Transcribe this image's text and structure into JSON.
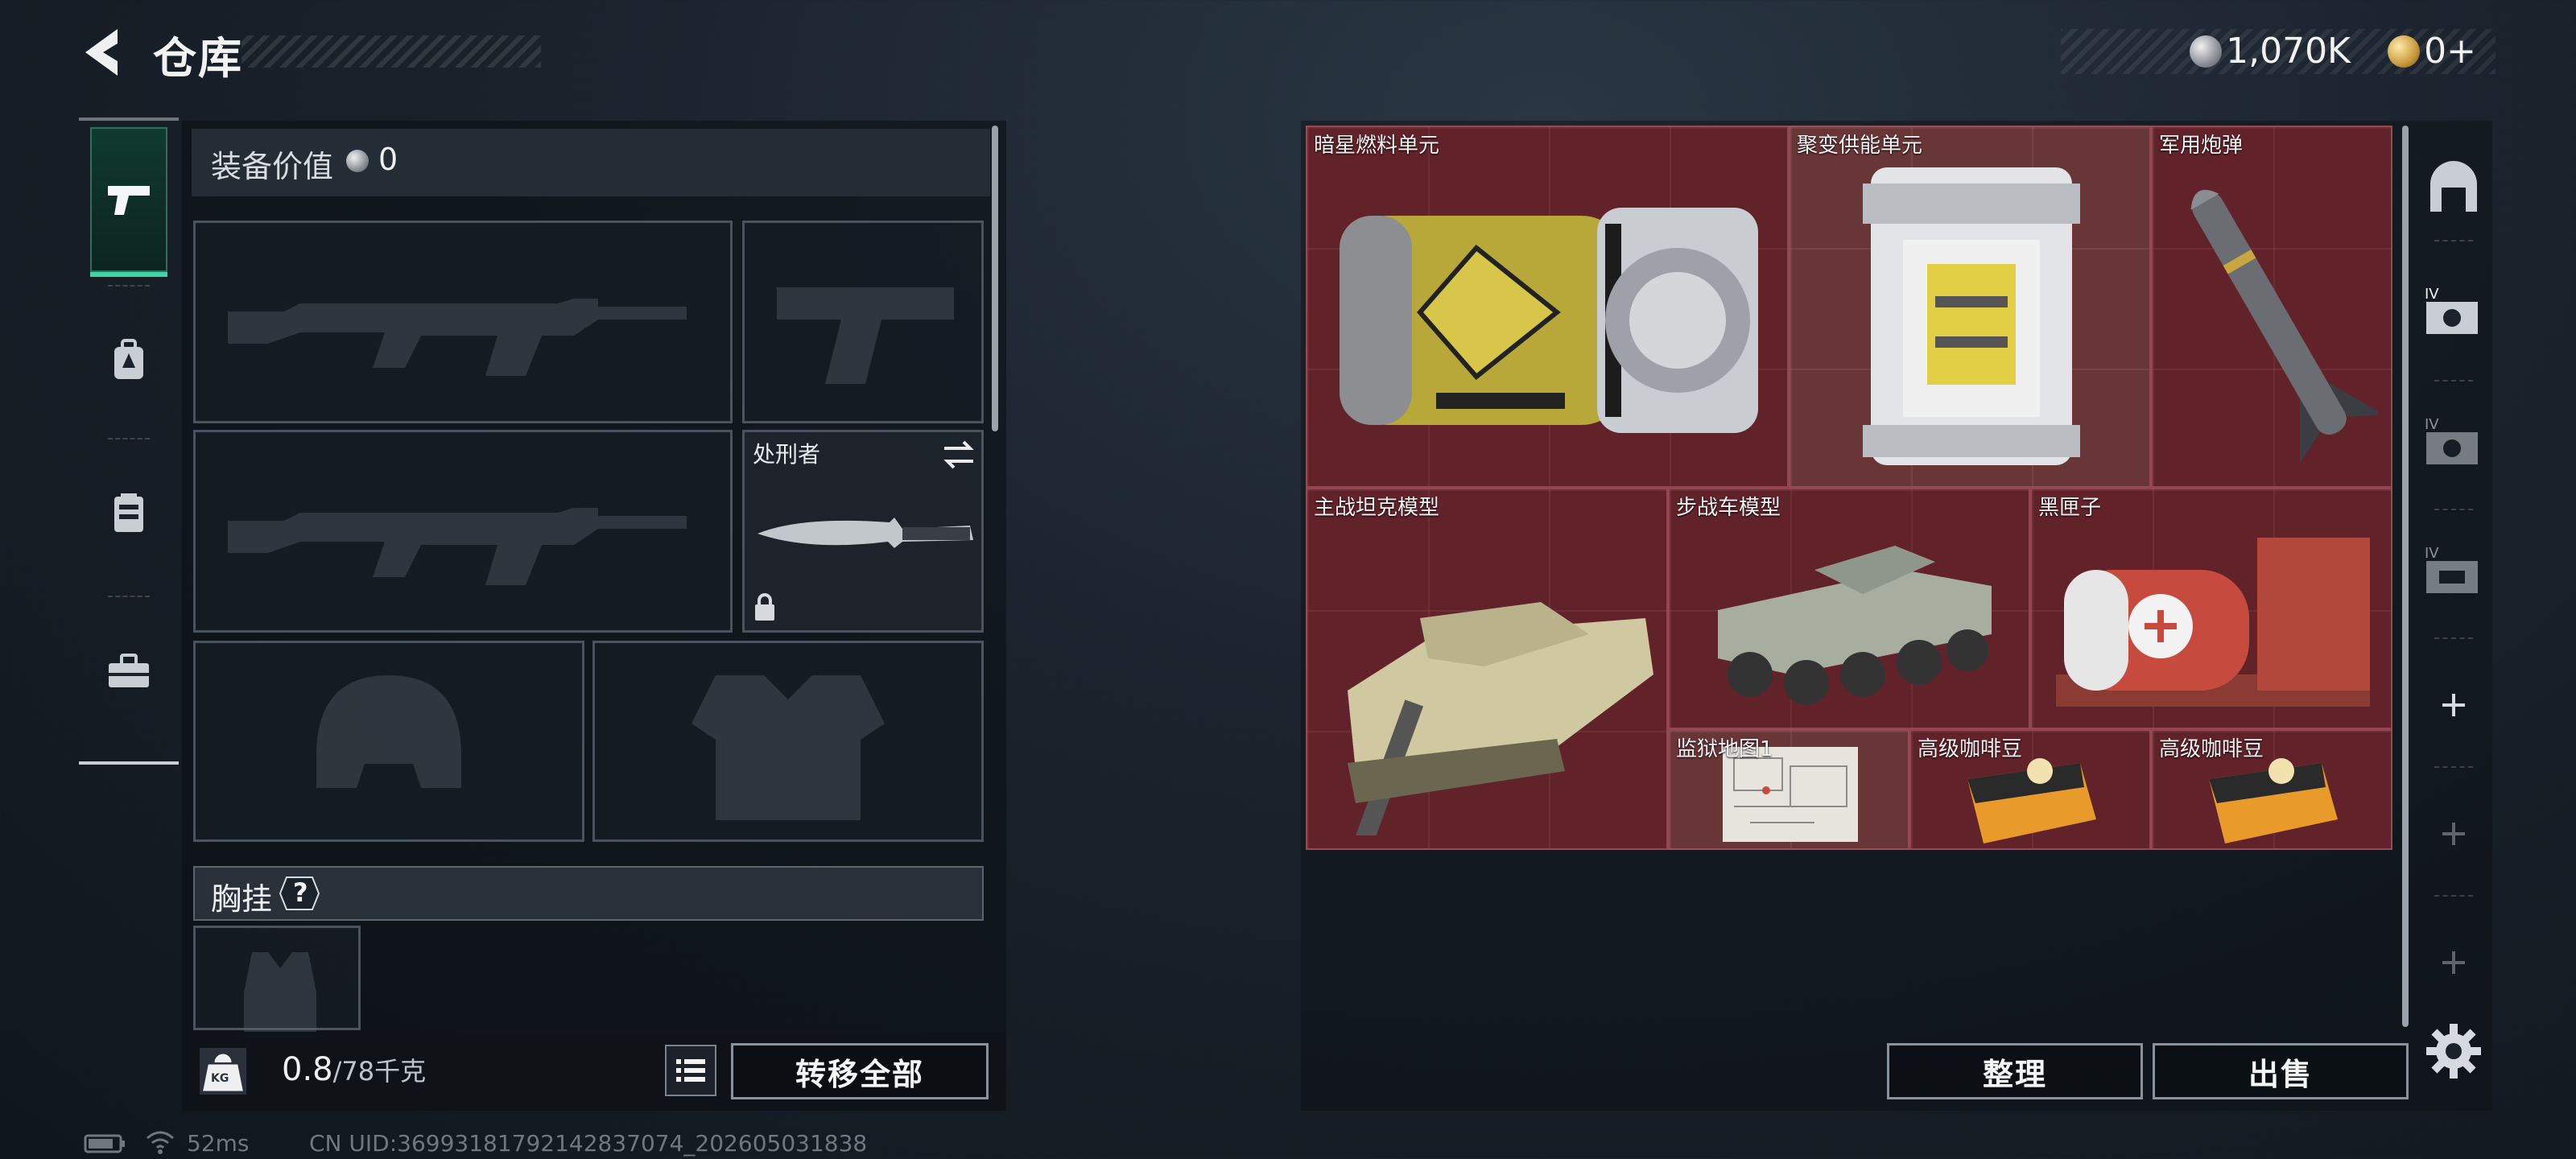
{
  "header": {
    "title": "仓库",
    "currency_silver": "1,070K",
    "currency_gold": "0+"
  },
  "rail": {
    "items": [
      {
        "icon": "pistol-icon",
        "active": true
      },
      {
        "icon": "backpack-icon",
        "active": false
      },
      {
        "icon": "chest-rig-icon",
        "active": false
      },
      {
        "icon": "toolbox-icon",
        "active": false
      }
    ]
  },
  "equipment": {
    "value_label": "装备价值",
    "value": "0",
    "melee_name": "处刑者",
    "section_chest": "胸挂",
    "help_symbol": "?",
    "weight_current": "0.8",
    "weight_cap": "/78千克",
    "kg_label": "KG",
    "transfer_all": "转移全部"
  },
  "inventory": {
    "items": [
      {
        "name": "暗星燃料单元"
      },
      {
        "name": "聚变供能单元"
      },
      {
        "name": "军用炮弹"
      },
      {
        "name": "主战坦克模型"
      },
      {
        "name": "步战车模型"
      },
      {
        "name": "黑匣子"
      },
      {
        "name": "监狱地图1"
      },
      {
        "name": "高级咖啡豆"
      },
      {
        "name": "高级咖啡豆"
      }
    ],
    "sort_label": "整理",
    "sell_label": "出售"
  },
  "status": {
    "ping": "52ms",
    "uid": "CN UID:36993181792142837074_202605031838"
  },
  "colors": {
    "accent": "#3ed6a6",
    "grid_bg": "#5b2229"
  }
}
